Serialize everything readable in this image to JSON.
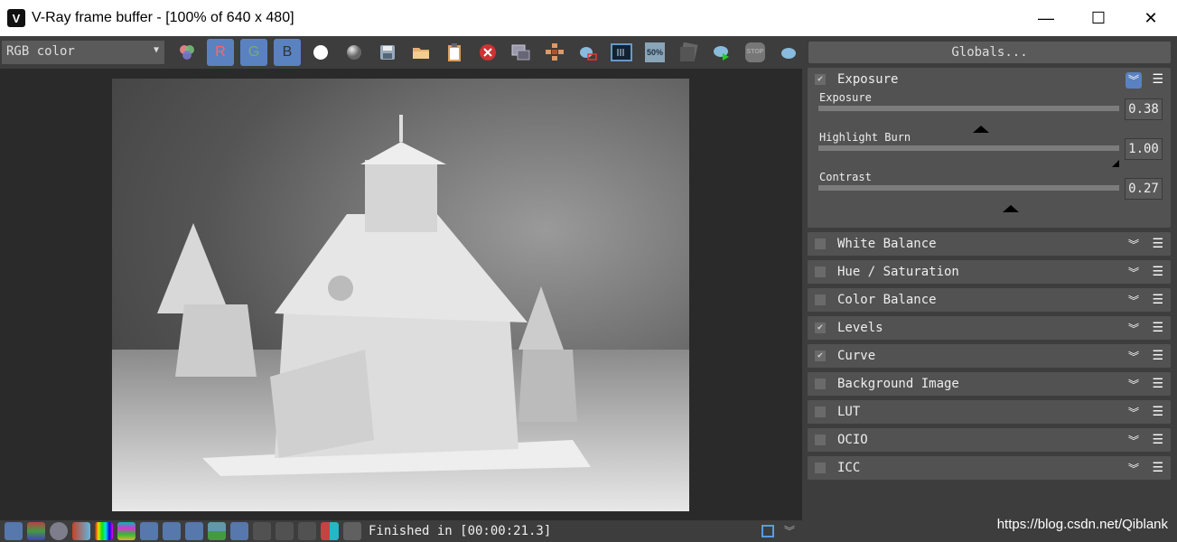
{
  "window": {
    "title": "V-Ray frame buffer - [100% of 640 x 480]",
    "minimize": "—",
    "maximize": "☐",
    "close": "✕"
  },
  "toolbar": {
    "channel_select": "RGB color",
    "channels": [
      "R",
      "G",
      "B"
    ],
    "icons": [
      "color-circles-icon",
      "white-sphere-icon",
      "gray-sphere-icon",
      "save-icon",
      "open-folder-icon",
      "clipboard-icon",
      "clear-icon",
      "region-icon",
      "track-mouse-icon",
      "teapot-region-icon",
      "compare-icon",
      "zoom-50-icon",
      "lens-icon",
      "render-icon",
      "stop-icon",
      "teapot-icon"
    ],
    "zoom_label": "50%",
    "stop_label": "STOP"
  },
  "status": {
    "text": "Finished in [00:00:21.3]"
  },
  "panel": {
    "globals": "Globals...",
    "exposure": {
      "title": "Exposure",
      "checked": true,
      "sliders": [
        {
          "label": "Exposure",
          "value": "0.38",
          "fraction": 0.54
        },
        {
          "label": "Highlight Burn",
          "value": "1.00",
          "fraction": 1.0
        },
        {
          "label": "Contrast",
          "value": "0.27",
          "fraction": 0.64
        }
      ]
    },
    "sections": [
      {
        "title": "White Balance",
        "checked": false
      },
      {
        "title": "Hue / Saturation",
        "checked": false
      },
      {
        "title": "Color Balance",
        "checked": false
      },
      {
        "title": "Levels",
        "checked": true
      },
      {
        "title": "Curve",
        "checked": true
      },
      {
        "title": "Background Image",
        "checked": false
      },
      {
        "title": "LUT",
        "checked": false
      },
      {
        "title": "OCIO",
        "checked": false
      },
      {
        "title": "ICC",
        "checked": false
      }
    ]
  },
  "watermark": "https://blog.csdn.net/Qiblank",
  "colors": {
    "accent": "#5a82c0",
    "panel": "#525252",
    "bg": "#3d3d3d"
  }
}
